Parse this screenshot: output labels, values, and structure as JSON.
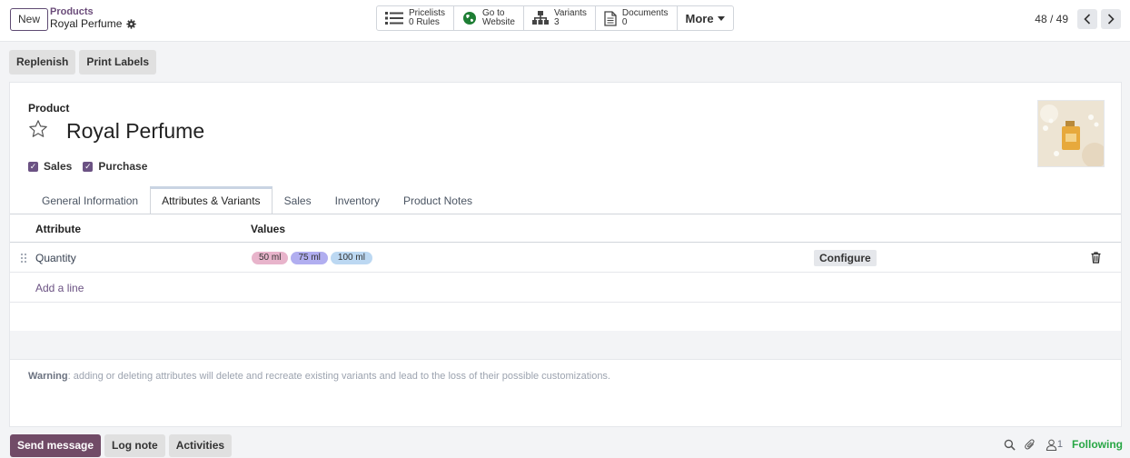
{
  "topbar": {
    "new_label": "New",
    "breadcrumb_parent": "Products",
    "breadcrumb_current": "Royal Perfume",
    "smart_buttons": [
      {
        "line1": "Pricelists",
        "line2": "0 Rules",
        "icon": "list-icon"
      },
      {
        "line1": "Go to",
        "line2": "Website",
        "icon": "globe-icon"
      },
      {
        "line1": "Variants",
        "line2": "3",
        "icon": "sitemap-icon"
      },
      {
        "line1": "Documents",
        "line2": "0",
        "icon": "document-icon"
      }
    ],
    "more_label": "More",
    "pager": "48 / 49"
  },
  "actions": {
    "replenish": "Replenish",
    "print_labels": "Print Labels"
  },
  "form": {
    "product_label": "Product",
    "product_name": "Royal Perfume",
    "sales_label": "Sales",
    "purchase_label": "Purchase",
    "sales_checked": true,
    "purchase_checked": true
  },
  "tabs": [
    {
      "label": "General Information",
      "active": false
    },
    {
      "label": "Attributes & Variants",
      "active": true
    },
    {
      "label": "Sales",
      "active": false
    },
    {
      "label": "Inventory",
      "active": false
    },
    {
      "label": "Product Notes",
      "active": false
    }
  ],
  "table": {
    "col_attribute": "Attribute",
    "col_values": "Values",
    "rows": [
      {
        "attribute": "Quantity",
        "values": [
          {
            "label": "50 ml",
            "color": "#e8b4cb"
          },
          {
            "label": "75 ml",
            "color": "#b1aef0"
          },
          {
            "label": "100 ml",
            "color": "#bcd8f2"
          }
        ],
        "configure": "Configure"
      }
    ],
    "add_line": "Add a line"
  },
  "warning": {
    "prefix": "Warning",
    "text": ": adding or deleting attributes will delete and recreate existing variants and lead to the loss of their possible customizations."
  },
  "chatter": {
    "send_message": "Send message",
    "log_note": "Log note",
    "activities": "Activities",
    "followers_count": "1",
    "following": "Following"
  },
  "colors": {
    "primary": "#714b67",
    "checkbox": "#6b5283",
    "following": "#28a745"
  }
}
